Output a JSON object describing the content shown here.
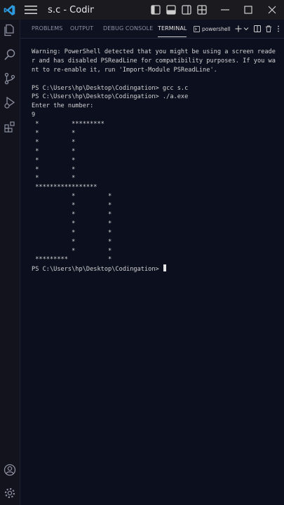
{
  "window": {
    "title": "s.c - Codin"
  },
  "panel": {
    "tabs": [
      {
        "label": "PROBLEMS",
        "active": false
      },
      {
        "label": "OUTPUT",
        "active": false
      },
      {
        "label": "DEBUG CONSOLE",
        "active": false
      },
      {
        "label": "TERMINAL",
        "active": true
      }
    ],
    "terminal_name": "powershell"
  },
  "terminal": {
    "lines": [
      "Warning: PowerShell detected that you might be using a screen reade",
      "r and has disabled PSReadLine for compatibility purposes. If you wa",
      "nt to re-enable it, run 'Import-Module PSReadLine'.",
      "",
      "PS C:\\Users\\hp\\Desktop\\Codingation> gcc s.c",
      "PS C:\\Users\\hp\\Desktop\\Codingation> ./a.exe",
      "Enter the number:",
      "9",
      " *         *********",
      " *         *",
      " *         *",
      " *         *",
      " *         *",
      " *         *",
      " *         *",
      " *****************",
      "           *         *",
      "           *         *",
      "           *         *",
      "           *         *",
      "           *         *",
      "           *         *",
      "           *         *",
      " *********           *"
    ],
    "prompt": "PS C:\\Users\\hp\\Desktop\\Codingation> "
  },
  "colors": {
    "accent": "#0078d4",
    "background": "#0b0f1e"
  }
}
